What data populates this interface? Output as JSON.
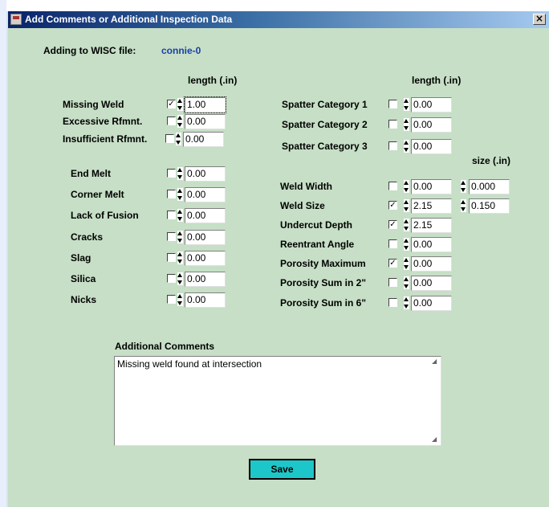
{
  "window": {
    "title": "Add Comments or Additional Inspection Data",
    "close_glyph": "×"
  },
  "file": {
    "label": "Adding to WISC file:",
    "name": "connie-0"
  },
  "headers": {
    "length_left": "length (.in)",
    "length_right": "length (.in)",
    "size": "size (.in)"
  },
  "left_defects": [
    {
      "label": "Missing Weld",
      "checked": true,
      "value": "1.00"
    },
    {
      "label": "Excessive Rfmnt.",
      "checked": false,
      "value": "0.00"
    },
    {
      "label": "Insufficient Rfmnt.",
      "checked": false,
      "value": "0.00"
    },
    {
      "label": "End Melt",
      "checked": false,
      "value": "0.00"
    },
    {
      "label": "Corner Melt",
      "checked": false,
      "value": "0.00"
    },
    {
      "label": "Lack of Fusion",
      "checked": false,
      "value": "0.00"
    },
    {
      "label": "Cracks",
      "checked": false,
      "value": "0.00"
    },
    {
      "label": "Slag",
      "checked": false,
      "value": "0.00"
    },
    {
      "label": "Silica",
      "checked": false,
      "value": "0.00"
    },
    {
      "label": "Nicks",
      "checked": false,
      "value": "0.00"
    }
  ],
  "right_defects": [
    {
      "label": "Spatter Category 1",
      "checked": false,
      "value": "0.00"
    },
    {
      "label": "Spatter Category 2",
      "checked": false,
      "value": "0.00"
    },
    {
      "label": "Spatter Category 3",
      "checked": false,
      "value": "0.00"
    },
    {
      "label": "Weld Width",
      "checked": false,
      "value": "0.00",
      "size": "0.000"
    },
    {
      "label": "Weld Size",
      "checked": true,
      "value": "2.15",
      "size": "0.150"
    },
    {
      "label": "Undercut Depth",
      "checked": true,
      "value": "2.15"
    },
    {
      "label": "Reentrant Angle",
      "checked": false,
      "value": "0.00"
    },
    {
      "label": "Porosity Maximum",
      "checked": true,
      "value": "0.00"
    },
    {
      "label": "Porosity Sum in 2\"",
      "checked": false,
      "value": "0.00"
    },
    {
      "label": "Porosity Sum in 6\"",
      "checked": false,
      "value": "0.00"
    }
  ],
  "comments": {
    "label": "Additional Comments",
    "value": "Missing weld found at intersection"
  },
  "save_label": "Save",
  "colors": {
    "panel": "#c6dfc6",
    "save_button": "#1dc7c9",
    "filename": "#1a3fa8"
  }
}
